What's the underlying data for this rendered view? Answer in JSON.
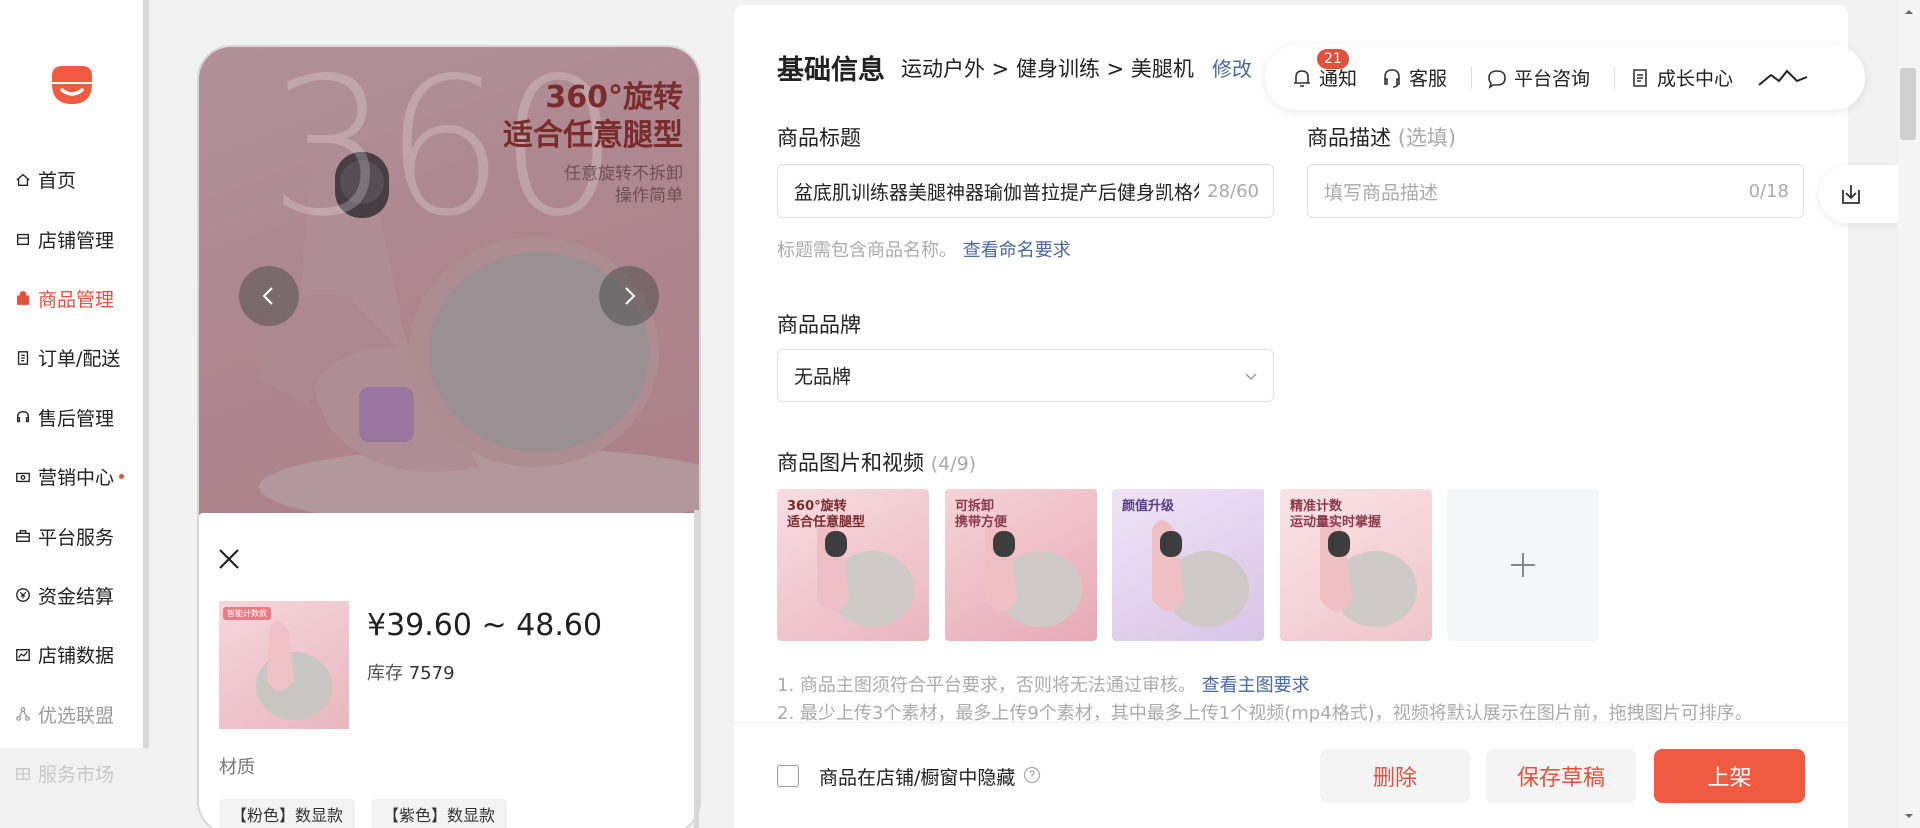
{
  "colors": {
    "accent": "#e4503d",
    "link": "#4a6a9b",
    "publish_button": "#f05a41"
  },
  "sidebar": {
    "logo_icon": "shop-logo-icon",
    "items": [
      {
        "label": "首页",
        "icon": "home-icon",
        "state": "normal"
      },
      {
        "label": "店铺管理",
        "icon": "store-icon",
        "state": "normal"
      },
      {
        "label": "商品管理",
        "icon": "bag-icon",
        "state": "active"
      },
      {
        "label": "订单/配送",
        "icon": "order-icon",
        "state": "normal"
      },
      {
        "label": "售后管理",
        "icon": "headset-icon",
        "state": "normal"
      },
      {
        "label": "营销中心",
        "icon": "marketing-icon",
        "state": "normal",
        "dot": true
      },
      {
        "label": "平台服务",
        "icon": "service-icon",
        "state": "normal"
      },
      {
        "label": "资金结算",
        "icon": "money-icon",
        "state": "normal"
      },
      {
        "label": "店铺数据",
        "icon": "chart-icon",
        "state": "normal"
      },
      {
        "label": "优选联盟",
        "icon": "alliance-icon",
        "state": "muted"
      },
      {
        "label": "服务市场",
        "icon": "market-icon",
        "state": "faded"
      }
    ]
  },
  "preview": {
    "hero_big_text": "360",
    "hero_title_1": "360°旋转",
    "hero_title_2": "适合任意腿型",
    "hero_sub_1": "任意旋转不拆卸",
    "hero_sub_2": "操作简单",
    "sku_tag": "智能计数款",
    "price": "¥39.60 ~ 48.60",
    "stock_label": "库存",
    "stock_value": "7579",
    "attr_label": "材质",
    "chips": [
      "【粉色】数显款",
      "【紫色】数显款"
    ]
  },
  "topbar": {
    "notify_label": "通知",
    "notify_count": "21",
    "service_label": "客服",
    "consult_label": "平台咨询",
    "growth_label": "成长中心"
  },
  "form": {
    "heading": "基础信息",
    "breadcrumb": "运动户外 > 健身训练 > 美腿机",
    "edit_label": "修改",
    "title_label": "商品标题",
    "title_value": "盆底肌训练器美腿神器瑜伽普拉提产后健身凯格尔",
    "title_count": "28/60",
    "title_hint": "标题需包含商品名称。",
    "title_hint_link": "查看命名要求",
    "desc_label": "商品描述",
    "desc_optional": "(选填)",
    "desc_placeholder": "填写商品描述",
    "desc_count": "0/18",
    "brand_label": "商品品牌",
    "brand_value": "无品牌",
    "media_label": "商品图片和视频",
    "media_count": "(4/9)",
    "media": [
      {
        "caption_1": "360°旋转",
        "caption_2": "适合任意腿型",
        "color": "#7a2b2b"
      },
      {
        "caption_1": "可拆卸",
        "caption_2": "携带方便",
        "color": "#8a3a4a"
      },
      {
        "caption_1": "颜值升级",
        "caption_2": "",
        "color": "#5a3c8c"
      },
      {
        "caption_1": "精准计数",
        "caption_2": "运动量实时掌握",
        "color": "#8a3a4a"
      }
    ],
    "note_1": "1. 商品主图须符合平台要求，否则将无法通过审核。",
    "note_1_link": "查看主图要求",
    "note_2": "2. 最少上传3个素材，最多上传9个素材，其中最多上传1个视频(mp4格式)，视频将默认展示在图片前，拖拽图片可排序。"
  },
  "footer": {
    "hide_label": "商品在店铺/橱窗中隐藏",
    "delete_label": "删除",
    "draft_label": "保存草稿",
    "publish_label": "上架"
  }
}
